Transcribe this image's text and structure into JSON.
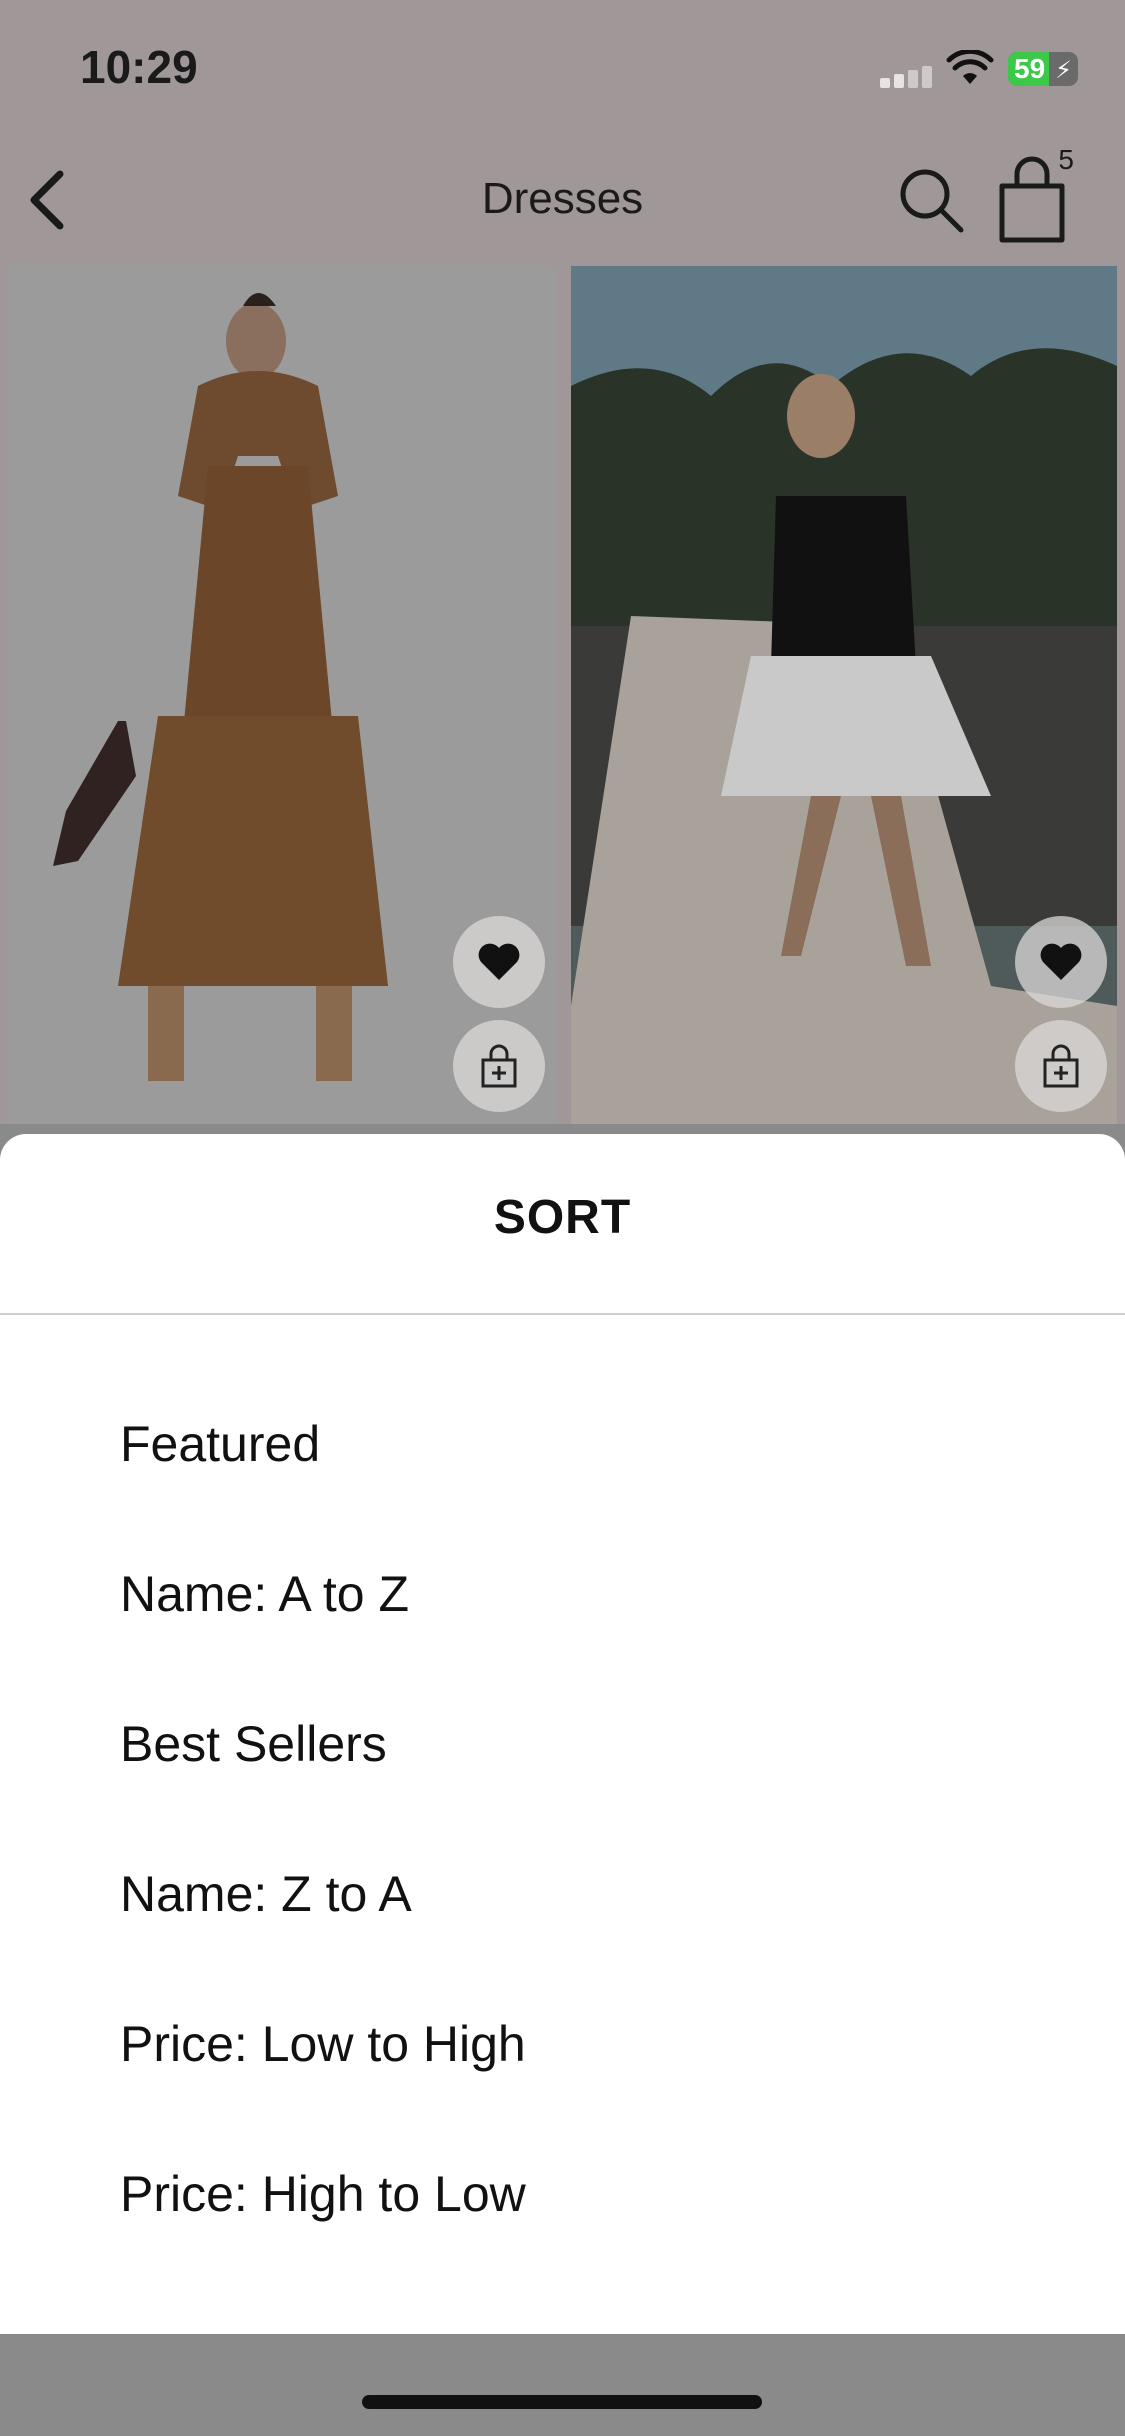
{
  "status_bar": {
    "time": "10:29",
    "battery_level": "59",
    "battery_color": "#3cc94a"
  },
  "nav": {
    "back_icon": "chevron-left-icon",
    "title": "Dresses",
    "search_icon": "search-icon",
    "bag_icon": "shopping-bag-icon",
    "bag_count": "5"
  },
  "products": [
    {
      "name": "brown-tiered-maxi-dress",
      "wishlist_icon": "heart-icon",
      "add_icon": "add-to-bag-icon"
    },
    {
      "name": "black-white-mini-dress",
      "wishlist_icon": "heart-icon",
      "add_icon": "add-to-bag-icon"
    }
  ],
  "sort_sheet": {
    "title": "SORT",
    "options": [
      "Featured",
      "Name: A to Z",
      "Best Sellers",
      "Name: Z to A",
      "Price: Low to High",
      "Price: High to Low"
    ]
  }
}
